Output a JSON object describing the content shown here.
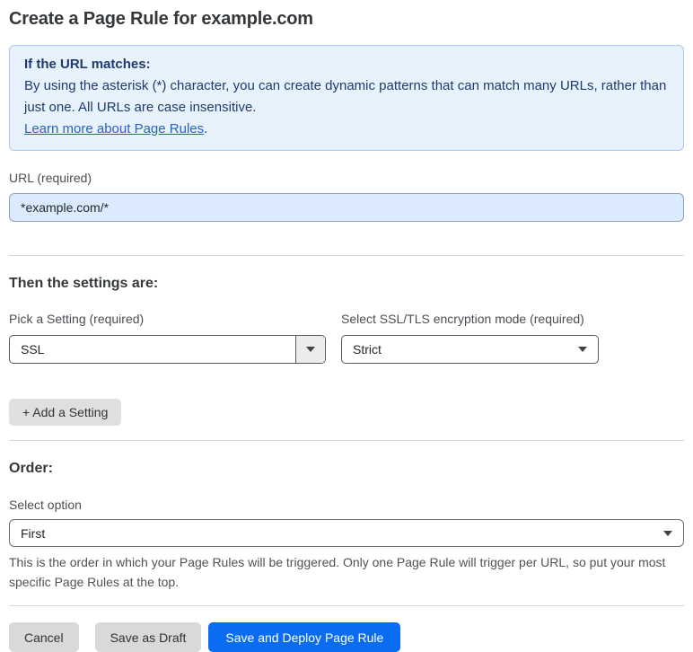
{
  "page": {
    "title": "Create a Page Rule for example.com"
  },
  "info_box": {
    "heading": "If the URL matches:",
    "body": "By using the asterisk (*) character, you can create dynamic patterns that can match many URLs, rather than just one. All URLs are case insensitive.",
    "link_label": "Learn more about Page Rules",
    "link_suffix": "."
  },
  "url_field": {
    "label": "URL (required)",
    "value": "*example.com/*"
  },
  "settings_section": {
    "heading": "Then the settings are:",
    "setting_picker": {
      "label": "Pick a Setting (required)",
      "value": "SSL"
    },
    "ssl_mode_picker": {
      "label": "Select SSL/TLS encryption mode (required)",
      "value": "Strict"
    },
    "add_setting_label": "+ Add a Setting"
  },
  "order_section": {
    "heading": "Order:",
    "select_label": "Select option",
    "selected_value": "First",
    "help_text": "This is the order in which your Page Rules will be triggered. Only one Page Rule will trigger per URL, so put your most specific Page Rules at the top."
  },
  "footer": {
    "cancel_label": "Cancel",
    "save_draft_label": "Save as Draft",
    "save_deploy_label": "Save and Deploy Page Rule"
  },
  "icons": {
    "dropdown_caret": "caret-down-icon"
  },
  "colors": {
    "info_box_bg": "#e8f2fc",
    "info_box_border": "#abc9ec",
    "info_box_text": "#1e3a6e",
    "link_blue": "#2563cb",
    "url_input_bg": "#dbeafd",
    "primary_button_blue": "#0a6cf1",
    "gray_button": "#d9d9d9",
    "heading_text": "#35383b"
  }
}
